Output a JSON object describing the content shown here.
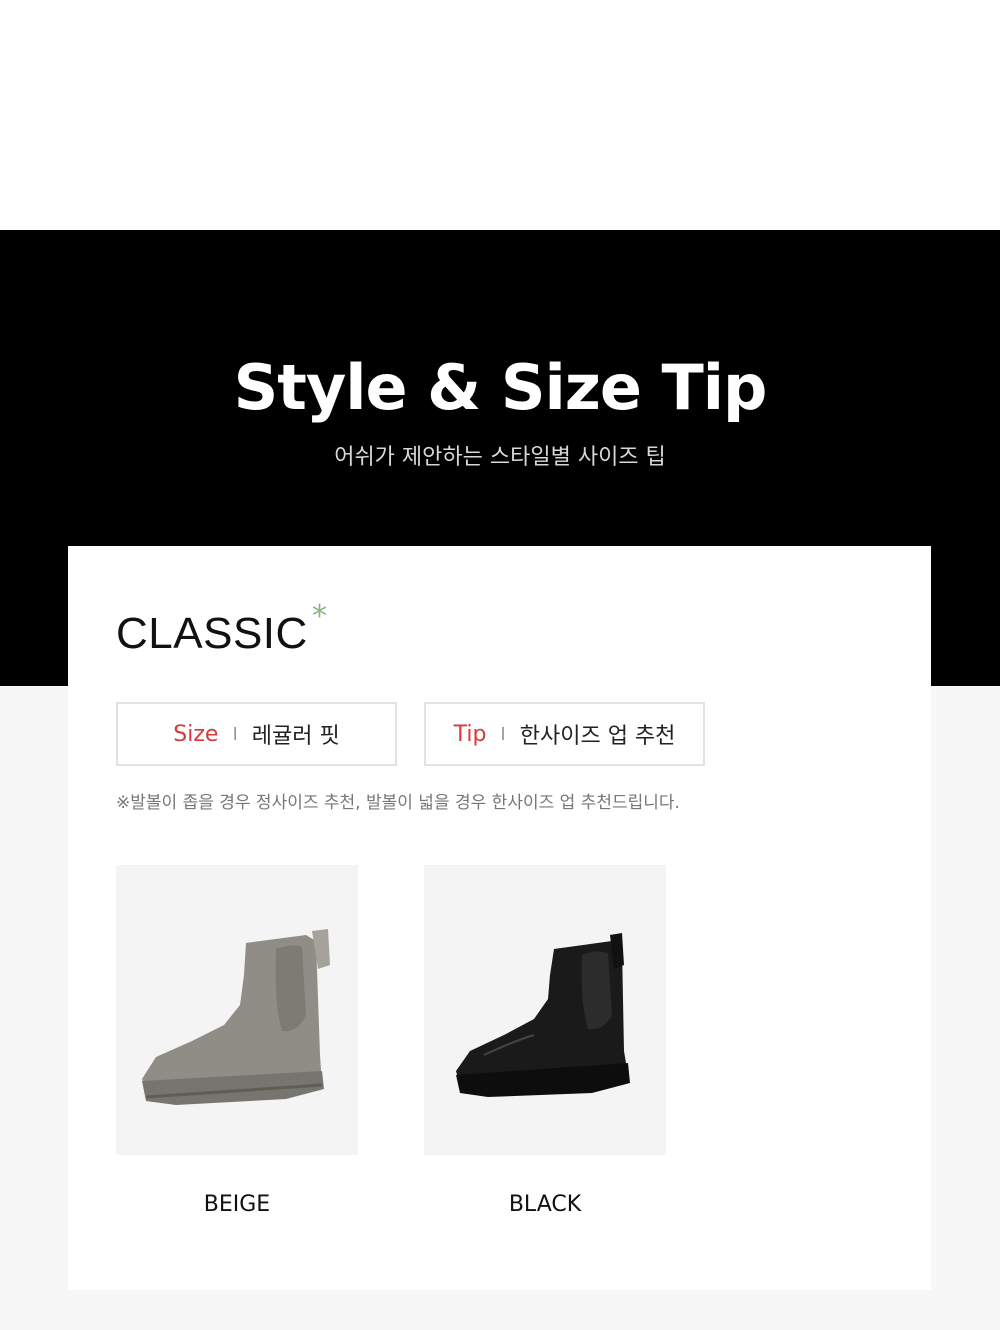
{
  "header": {
    "title": "Style & Size Tip",
    "subtitle": "어쉬가 제안하는 스타일별 사이즈 팁"
  },
  "section": {
    "heading": "CLASSIC",
    "asterisk": "*",
    "size_box": {
      "label": "Size",
      "separator": "I",
      "value": "레귤러 핏"
    },
    "tip_box": {
      "label": "Tip",
      "separator": "I",
      "value": "한사이즈 업 추천"
    },
    "note": "※발볼이 좁을 경우 정사이즈 추천, 발볼이 넓을 경우 한사이즈 업 추천드립니다."
  },
  "products": [
    {
      "color_name": "BEIGE",
      "icon": "beige-chelsea-boot-icon",
      "boot_color": "#8f8d86"
    },
    {
      "color_name": "BLACK",
      "icon": "black-chelsea-boot-icon",
      "boot_color": "#1a1a1a"
    }
  ],
  "colors": {
    "accent_red": "#d63a3a",
    "asterisk_green": "#8bb37a"
  }
}
